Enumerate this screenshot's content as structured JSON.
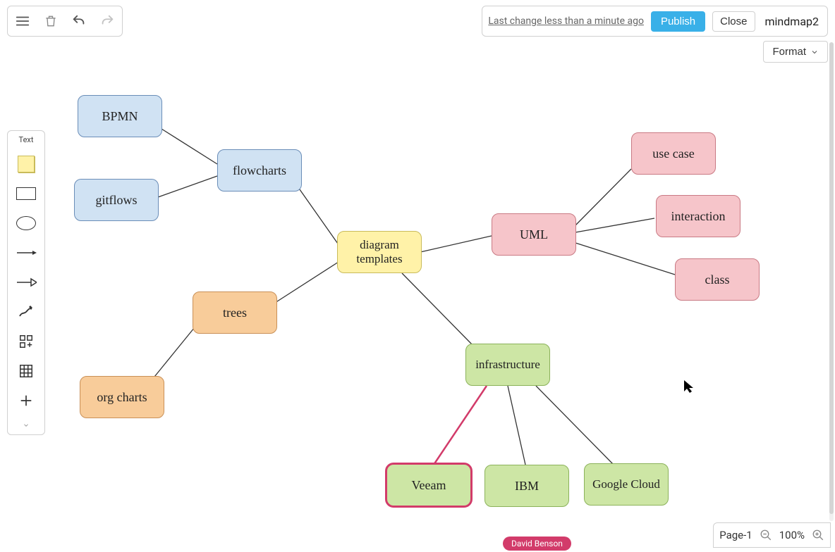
{
  "header": {
    "last_change": "Last change less than a minute ago",
    "publish": "Publish",
    "close": "Close",
    "doc_name": "mindmap2",
    "format": "Format"
  },
  "sidebar": {
    "text_label": "Text"
  },
  "nodes": {
    "bpmn": "BPMN",
    "flowcharts": "flowcharts",
    "gitflows": "gitflows",
    "diagram_templates": "diagram templates",
    "trees": "trees",
    "org_charts": "org charts",
    "uml": "UML",
    "use_case": "use case",
    "interaction": "interaction",
    "class": "class",
    "infrastructure": "infrastructure",
    "veeam": "Veeam",
    "ibm": "IBM",
    "google_cloud": "Google Cloud"
  },
  "user_badge": "David Benson",
  "footer": {
    "page": "Page-1",
    "zoom": "100%"
  },
  "colors": {
    "blue": "#d0e2f3",
    "yellow": "#fff2a8",
    "orange": "#f8cc9a",
    "pink": "#f6c5ca",
    "green": "#cde6a5",
    "accent_selected": "#d23b6a"
  }
}
